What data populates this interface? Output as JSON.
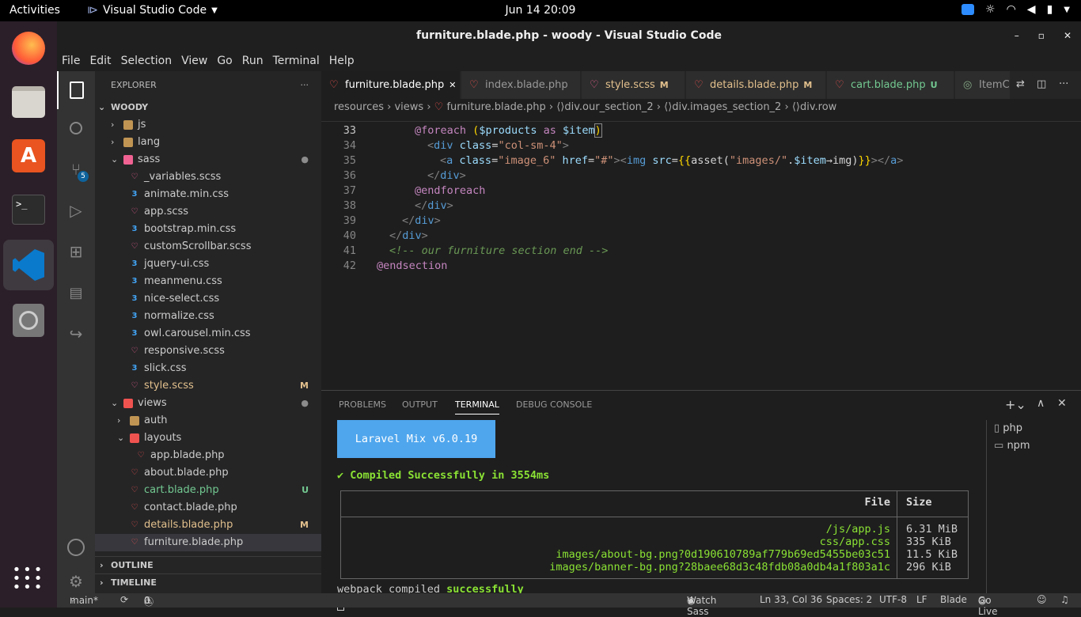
{
  "topbar": {
    "activities": "Activities",
    "app": "Visual Studio Code",
    "clock": "Jun 14  20:09"
  },
  "window": {
    "title": "furniture.blade.php - woody - Visual Studio Code",
    "controls": [
      "–",
      "▫",
      "✕"
    ]
  },
  "menu": [
    "File",
    "Edit",
    "Selection",
    "View",
    "Go",
    "Run",
    "Terminal",
    "Help"
  ],
  "scm_badge": "5",
  "sidebar": {
    "header": "EXPLORER",
    "dots": "···",
    "root": "WOODY",
    "outline": "OUTLINE",
    "timeline": "TIMELINE",
    "items": [
      {
        "name": "js",
        "type": "folder",
        "depth": 1,
        "chev": "›",
        "status": ""
      },
      {
        "name": "lang",
        "type": "folder",
        "depth": 1,
        "chev": "›",
        "status": ""
      },
      {
        "name": "sass",
        "type": "folder-scss",
        "depth": 1,
        "chev": "⌄",
        "status": "●"
      },
      {
        "name": "_variables.scss",
        "type": "scss",
        "depth": 2,
        "status": ""
      },
      {
        "name": "animate.min.css",
        "type": "css",
        "depth": 2,
        "status": ""
      },
      {
        "name": "app.scss",
        "type": "scss",
        "depth": 2,
        "status": ""
      },
      {
        "name": "bootstrap.min.css",
        "type": "css",
        "depth": 2,
        "status": ""
      },
      {
        "name": "customScrollbar.scss",
        "type": "scss",
        "depth": 2,
        "status": ""
      },
      {
        "name": "jquery-ui.css",
        "type": "css",
        "depth": 2,
        "status": ""
      },
      {
        "name": "meanmenu.css",
        "type": "css",
        "depth": 2,
        "status": ""
      },
      {
        "name": "nice-select.css",
        "type": "css",
        "depth": 2,
        "status": ""
      },
      {
        "name": "normalize.css",
        "type": "css",
        "depth": 2,
        "status": ""
      },
      {
        "name": "owl.carousel.min.css",
        "type": "css",
        "depth": 2,
        "status": ""
      },
      {
        "name": "responsive.scss",
        "type": "scss",
        "depth": 2,
        "status": ""
      },
      {
        "name": "slick.css",
        "type": "css",
        "depth": 2,
        "status": ""
      },
      {
        "name": "style.scss",
        "type": "scss",
        "depth": 2,
        "status": "M"
      },
      {
        "name": "views",
        "type": "folder-views",
        "depth": 1,
        "chev": "⌄",
        "status": "●"
      },
      {
        "name": "auth",
        "type": "folder",
        "depth": 2,
        "chev": "›",
        "status": ""
      },
      {
        "name": "layouts",
        "type": "folder-views",
        "depth": 2,
        "chev": "⌄",
        "status": ""
      },
      {
        "name": "app.blade.php",
        "type": "blade",
        "depth": 3,
        "status": ""
      },
      {
        "name": "about.blade.php",
        "type": "blade",
        "depth": 2,
        "status": ""
      },
      {
        "name": "cart.blade.php",
        "type": "blade",
        "depth": 2,
        "status": "U"
      },
      {
        "name": "contact.blade.php",
        "type": "blade",
        "depth": 2,
        "status": ""
      },
      {
        "name": "details.blade.php",
        "type": "blade",
        "depth": 2,
        "status": "M"
      },
      {
        "name": "furniture.blade.php",
        "type": "blade",
        "depth": 2,
        "status": ""
      }
    ]
  },
  "tabs": [
    {
      "label": "furniture.blade.php",
      "mark": "✕",
      "active": true
    },
    {
      "label": "index.blade.php",
      "mark": ""
    },
    {
      "label": "style.scss",
      "mark": "M"
    },
    {
      "label": "details.blade.php",
      "mark": "M"
    },
    {
      "label": "cart.blade.php",
      "mark": "U"
    },
    {
      "label": "ItemC",
      "mark": ""
    }
  ],
  "breadcrumb": [
    "resources",
    "views",
    "furniture.blade.php",
    "div.our_section_2",
    "div.images_section_2",
    "div.row"
  ],
  "code": {
    "line_numbers": [
      "33",
      "34",
      "35",
      "36",
      "37",
      "38",
      "39",
      "40",
      "41",
      "42"
    ]
  },
  "panel": {
    "tabs": [
      "PROBLEMS",
      "OUTPUT",
      "TERMINAL",
      "DEBUG CONSOLE"
    ],
    "active": "TERMINAL",
    "terminals": [
      "php",
      "npm"
    ],
    "banner": "Laravel Mix v6.0.19",
    "compiled": "✔ Compiled Successfully in 3554ms",
    "table_headers": [
      "File",
      "Size"
    ],
    "files": [
      {
        "file": "/js/app.js",
        "size": "6.31 MiB"
      },
      {
        "file": "css/app.css",
        "size": "335 KiB"
      },
      {
        "file": "images/about-bg.png?0d190610789af779b69ed5455be03c51",
        "size": "11.5 KiB"
      },
      {
        "file": "images/banner-bg.png?28baee68d3c48fdb08a0db4a1f803a1c",
        "size": "296 KiB"
      }
    ],
    "webpack_prefix": "webpack compiled ",
    "webpack_success": "successfully"
  },
  "status": {
    "branch": "main*",
    "errors": "0",
    "warnings": "0",
    "watch": "Watch Sass",
    "position": "Ln 33, Col 36",
    "spaces": "Spaces: 2",
    "encoding": "UTF-8",
    "eol": "LF",
    "language": "Blade",
    "golive": "Go Live"
  }
}
